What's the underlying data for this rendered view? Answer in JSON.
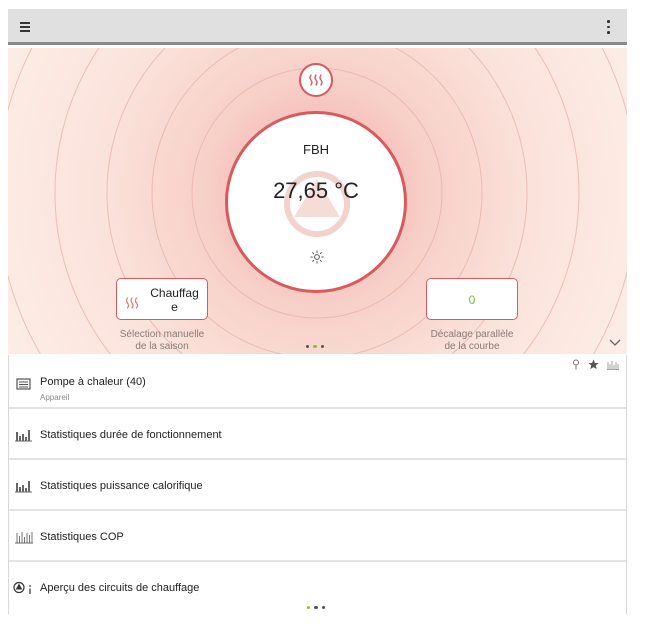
{
  "topbar": {
    "menu_icon": "hamburger-menu-icon",
    "more_icon": "kebab-menu-icon"
  },
  "hero": {
    "season_icon": "heating-waves-icon",
    "circuit_name": "FBH",
    "temperature": "27,65 °C",
    "mode_icon": "sun-icon",
    "season_tile": {
      "icon": "heating-waves-icon",
      "value": "Chauffag\ne",
      "caption": "Sélection manuelle\nde la saison"
    },
    "offset_tile": {
      "value": "0",
      "caption": "Décalage parallèle\nde la courbe"
    },
    "pager_active": 1,
    "pager_count": 3
  },
  "list": {
    "items": [
      {
        "icon": "device-icon",
        "label": "Pompe à chaleur (40)",
        "sublabel": "Appareil"
      },
      {
        "icon": "bar-chart-icon",
        "label": "Statistiques durée de fonctionnement"
      },
      {
        "icon": "bar-chart-icon",
        "label": "Statistiques puissance calorifique"
      },
      {
        "icon": "cop-chart-icon",
        "label": "Statistiques COP"
      },
      {
        "icon": "pump-info-icon",
        "label": "Aperçu des circuits de chauffage"
      }
    ],
    "row_actions": [
      "pin-icon",
      "star-icon",
      "cop-chart-icon"
    ],
    "pager_active": 0,
    "pager_count": 3
  },
  "colors": {
    "accent_red": "#d9595d",
    "accent_green": "#8cbf3f",
    "value_green": "#7dbb3b",
    "topbar": "#e0e0e0"
  }
}
